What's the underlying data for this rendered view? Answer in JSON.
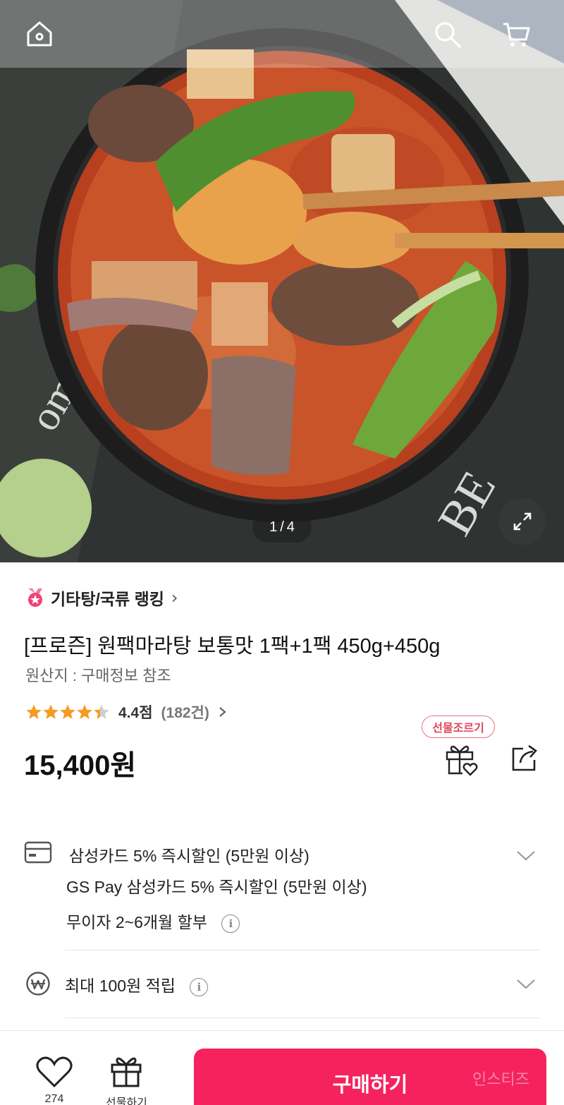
{
  "gallery": {
    "current": "1",
    "separator": "/",
    "total": "4"
  },
  "ranking": {
    "label": "기타탕/국류 랭킹",
    "arrow": "›"
  },
  "product": {
    "title": "[프로즌] 원팩마라탕 보통맛 1팩+1팩 450g+450g",
    "origin": "원산지 : 구매정보 참조",
    "rating_score": "4.4점",
    "rating_count": "(182건)",
    "rating_value": 4.4,
    "rating_max": 5,
    "price": "15,400원"
  },
  "actions": {
    "gift_badge": "선물조르기"
  },
  "benefits": {
    "card_line1": "삼성카드 5% 즉시할인 (5만원 이상)",
    "card_line2": "GS Pay 삼성카드 5% 즉시할인 (5만원 이상)",
    "installment": "무이자 2~6개월 할부",
    "points": "최대 100원 적립",
    "info_glyph": "i"
  },
  "bottom_bar": {
    "like_count": "274",
    "gift_label": "선물하기",
    "buy_label": "구매하기",
    "watermark": "인스티즈"
  },
  "colors": {
    "accent": "#f5225e",
    "star": "#f59a23",
    "gift_badge": "#e0475a"
  },
  "icons": [
    "home-icon",
    "search-icon",
    "cart-icon",
    "expand-icon",
    "ranking-badge-icon",
    "gift-icon",
    "share-icon",
    "card-icon",
    "won-coin-icon",
    "chevron-down-icon",
    "info-icon",
    "heart-icon"
  ]
}
